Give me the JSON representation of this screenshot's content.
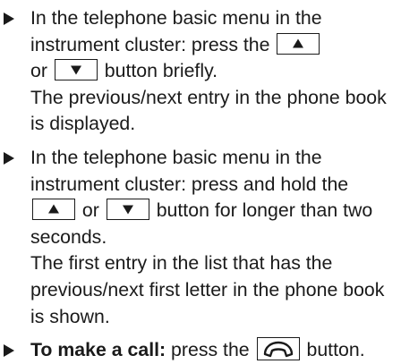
{
  "items": [
    {
      "line1": "In the telephone basic menu in the",
      "line2_pre": "instrument cluster: press the ",
      "line3_pre": "or ",
      "line3_post": " button briefly.",
      "line4": "The previous/next entry in the phone book",
      "line5": "is displayed."
    },
    {
      "line1": "In the telephone basic menu in the",
      "line2": "instrument cluster: press and hold the",
      "line3_mid": " or ",
      "line3_post": " button for longer than two",
      "line4": "seconds.",
      "line5": "The first entry in the list that has the",
      "line6": "previous/next first letter in the phone book",
      "line7": "is shown."
    },
    {
      "bold": "To make a call:",
      "pre": " press the ",
      "post": " button."
    }
  ],
  "icons": {
    "up": "up-arrow-key-icon",
    "down": "down-arrow-key-icon",
    "phone": "phone-handset-key-icon"
  }
}
